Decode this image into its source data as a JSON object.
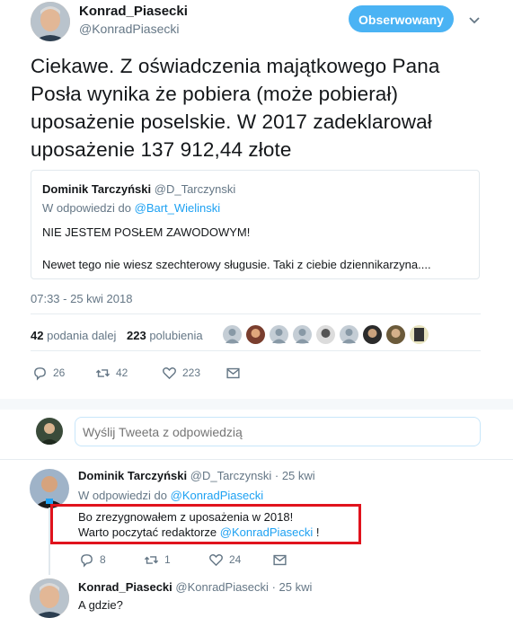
{
  "main_tweet": {
    "author_name": "Konrad_Piasecki",
    "author_handle": "@KonradPiasecki",
    "follow_label": "Obserwowany",
    "text_lines": [
      "Ciekawe. Z oświadczenia majątkowego Pana",
      "Posła wynika że pobiera (może pobierał)",
      "uposażenie poselskie. W 2017 zadeklarował",
      "uposażenie 137 912,44 złote"
    ],
    "timestamp": "07:33 - 25 kwi 2018",
    "retweet_count": "42",
    "retweet_label": "podania dalej",
    "like_count": "223",
    "like_label": "polubienia",
    "actions": {
      "replies": "26",
      "retweets": "42",
      "likes": "223"
    }
  },
  "quoted_tweet": {
    "author_name": "Dominik Tarczyński",
    "author_handle": "@D_Tarczynski",
    "reply_to_prefix": "W odpowiedzi do",
    "reply_to_handle": "@Bart_Wielinski",
    "line1": "NIE JESTEM POSŁEM ZAWODOWYM!",
    "line2": "Newet tego nie wiesz szechterowy sługusie. Taki z ciebie dziennikarzyna...."
  },
  "reply_box": {
    "placeholder": "Wyślij Tweeta z odpowiedzią"
  },
  "replies": [
    {
      "author_name": "Dominik Tarczyński",
      "author_handle": "@D_Tarczynski",
      "time": "· 25 kwi",
      "reply_to_prefix": "W odpowiedzi do",
      "reply_to_handle": "@KonradPiasecki",
      "line1": "Bo zrezygnowałem z uposażenia w 2018!",
      "line2_prefix": "Warto poczytać redaktorze",
      "line2_mention": "@KonradPiasecki",
      "line2_suffix": "!",
      "actions": {
        "replies": "8",
        "retweets": "1",
        "likes": "24"
      }
    },
    {
      "author_name": "Konrad_Piasecki",
      "author_handle": "@KonradPiasecki",
      "time": "· 25 kwi",
      "text": "A gdzie?"
    }
  ],
  "colors": {
    "accent": "#1da1f2",
    "highlight": "#e0131d",
    "muted": "#657786"
  }
}
